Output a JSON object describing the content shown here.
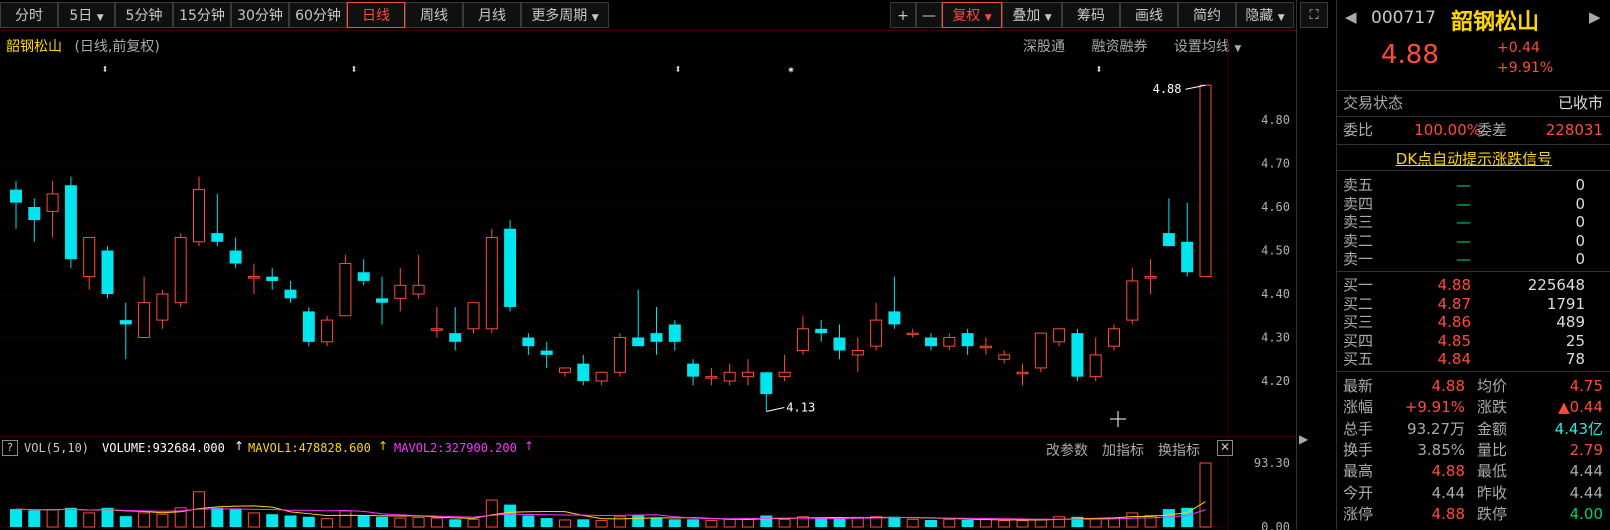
{
  "toolbar": {
    "left_buttons": [
      "分时",
      "5日",
      "5分钟",
      "15分钟",
      "30分钟",
      "60分钟",
      "日线",
      "周线",
      "月线",
      "更多周期"
    ],
    "right_buttons": [
      "+",
      "—",
      "复权",
      "叠加",
      "筹码",
      "画线",
      "简约",
      "隐藏"
    ],
    "active": "日线"
  },
  "chart_header": {
    "stock_name": "韶钢松山",
    "mode": "(日线,前复权)",
    "links": [
      "深股通",
      "融资融券",
      "设置均线"
    ]
  },
  "price_axis": [
    "4.80",
    "4.70",
    "4.60",
    "4.50",
    "4.40",
    "4.30",
    "4.20"
  ],
  "annotations": {
    "high_label": "4.88",
    "low_label": "4.13"
  },
  "volume_header": {
    "indicator": "VOL(5,10)",
    "volume": "VOLUME:932684.000",
    "mavol1": "MAVOL1:478828.600",
    "mavol2": "MAVOL2:327900.200",
    "links": [
      "改参数",
      "加指标",
      "换指标"
    ]
  },
  "volume_axis": [
    "93.30",
    "0.00"
  ],
  "chart_data": {
    "type": "candlestick",
    "ylim": [
      4.13,
      4.88
    ],
    "candles": [
      [
        4.64,
        4.66,
        4.55,
        4.61
      ],
      [
        4.6,
        4.62,
        4.52,
        4.57
      ],
      [
        4.59,
        4.66,
        4.53,
        4.63
      ],
      [
        4.65,
        4.67,
        4.46,
        4.48
      ],
      [
        4.44,
        4.52,
        4.41,
        4.53
      ],
      [
        4.5,
        4.51,
        4.39,
        4.4
      ],
      [
        4.34,
        4.38,
        4.25,
        4.33
      ],
      [
        4.3,
        4.44,
        4.3,
        4.38
      ],
      [
        4.34,
        4.41,
        4.32,
        4.4
      ],
      [
        4.38,
        4.54,
        4.37,
        4.53
      ],
      [
        4.52,
        4.67,
        4.51,
        4.64
      ],
      [
        4.54,
        4.63,
        4.51,
        4.52
      ],
      [
        4.5,
        4.53,
        4.46,
        4.47
      ],
      [
        4.44,
        4.47,
        4.4,
        4.44
      ],
      [
        4.44,
        4.46,
        4.41,
        4.43
      ],
      [
        4.41,
        4.43,
        4.38,
        4.39
      ],
      [
        4.36,
        4.37,
        4.28,
        4.29
      ],
      [
        4.29,
        4.35,
        4.28,
        4.34
      ],
      [
        4.35,
        4.49,
        4.35,
        4.47
      ],
      [
        4.45,
        4.48,
        4.42,
        4.43
      ],
      [
        4.39,
        4.44,
        4.33,
        4.38
      ],
      [
        4.39,
        4.46,
        4.36,
        4.42
      ],
      [
        4.4,
        4.49,
        4.39,
        4.42
      ],
      [
        4.32,
        4.37,
        4.3,
        4.32
      ],
      [
        4.31,
        4.37,
        4.27,
        4.29
      ],
      [
        4.32,
        4.37,
        4.31,
        4.38
      ],
      [
        4.32,
        4.55,
        4.31,
        4.53
      ],
      [
        4.55,
        4.57,
        4.36,
        4.37
      ],
      [
        4.3,
        4.31,
        4.26,
        4.28
      ],
      [
        4.27,
        4.29,
        4.23,
        4.26
      ],
      [
        4.22,
        4.23,
        4.21,
        4.23
      ],
      [
        4.24,
        4.26,
        4.19,
        4.2
      ],
      [
        4.2,
        4.22,
        4.19,
        4.22
      ],
      [
        4.22,
        4.31,
        4.21,
        4.3
      ],
      [
        4.3,
        4.41,
        4.3,
        4.28
      ],
      [
        4.31,
        4.37,
        4.26,
        4.29
      ],
      [
        4.33,
        4.34,
        4.27,
        4.29
      ],
      [
        4.24,
        4.25,
        4.19,
        4.21
      ],
      [
        4.21,
        4.23,
        4.19,
        4.21
      ],
      [
        4.2,
        4.24,
        4.19,
        4.22
      ],
      [
        4.21,
        4.25,
        4.19,
        4.22
      ],
      [
        4.22,
        4.22,
        4.13,
        4.17
      ],
      [
        4.21,
        4.26,
        4.2,
        4.22
      ],
      [
        4.27,
        4.35,
        4.26,
        4.32
      ],
      [
        4.32,
        4.34,
        4.29,
        4.31
      ],
      [
        4.3,
        4.33,
        4.25,
        4.27
      ],
      [
        4.26,
        4.3,
        4.22,
        4.27
      ],
      [
        4.28,
        4.38,
        4.27,
        4.34
      ],
      [
        4.36,
        4.44,
        4.32,
        4.33
      ],
      [
        4.31,
        4.32,
        4.3,
        4.31
      ],
      [
        4.3,
        4.31,
        4.27,
        4.28
      ],
      [
        4.28,
        4.31,
        4.27,
        4.3
      ],
      [
        4.31,
        4.32,
        4.26,
        4.28
      ],
      [
        4.28,
        4.3,
        4.26,
        4.28
      ],
      [
        4.25,
        4.27,
        4.24,
        4.26
      ],
      [
        4.22,
        4.24,
        4.19,
        4.22
      ],
      [
        4.23,
        4.29,
        4.22,
        4.31
      ],
      [
        4.29,
        4.32,
        4.28,
        4.32
      ],
      [
        4.31,
        4.32,
        4.2,
        4.21
      ],
      [
        4.21,
        4.3,
        4.2,
        4.26
      ],
      [
        4.28,
        4.33,
        4.27,
        4.32
      ],
      [
        4.34,
        4.46,
        4.33,
        4.43
      ],
      [
        4.44,
        4.48,
        4.4,
        4.44
      ],
      [
        4.54,
        4.62,
        4.51,
        4.51
      ],
      [
        4.52,
        4.61,
        4.44,
        4.45
      ],
      [
        4.44,
        4.88,
        4.44,
        4.88
      ]
    ],
    "volumes": [
      0.28,
      0.26,
      0.27,
      0.3,
      0.22,
      0.3,
      0.17,
      0.22,
      0.2,
      0.3,
      0.55,
      0.3,
      0.28,
      0.22,
      0.2,
      0.18,
      0.16,
      0.13,
      0.25,
      0.18,
      0.16,
      0.14,
      0.15,
      0.14,
      0.12,
      0.12,
      0.42,
      0.35,
      0.18,
      0.14,
      0.11,
      0.12,
      0.1,
      0.16,
      0.18,
      0.15,
      0.12,
      0.12,
      0.1,
      0.12,
      0.13,
      0.18,
      0.12,
      0.16,
      0.14,
      0.14,
      0.15,
      0.16,
      0.16,
      0.12,
      0.11,
      0.12,
      0.11,
      0.12,
      0.1,
      0.1,
      0.12,
      0.16,
      0.16,
      0.13,
      0.14,
      0.22,
      0.18,
      0.28,
      0.3,
      1.0
    ]
  },
  "quote": {
    "code": "000717",
    "name": "韶钢松山",
    "price": "4.88",
    "change": "+0.44",
    "change_pct": "+9.91%",
    "trade_status_label": "交易状态",
    "trade_status": "已收市",
    "weibi_label": "委比",
    "weibi": "100.00%",
    "weicha_label": "委差",
    "weicha": "228031",
    "dk_link": "DK点自动提示涨跌信号",
    "sell": [
      {
        "label": "卖五",
        "price": "—",
        "vol": "0"
      },
      {
        "label": "卖四",
        "price": "—",
        "vol": "0"
      },
      {
        "label": "卖三",
        "price": "—",
        "vol": "0"
      },
      {
        "label": "卖二",
        "price": "—",
        "vol": "0"
      },
      {
        "label": "卖一",
        "price": "—",
        "vol": "0"
      }
    ],
    "buy": [
      {
        "label": "买一",
        "price": "4.88",
        "vol": "225648"
      },
      {
        "label": "买二",
        "price": "4.87",
        "vol": "1791"
      },
      {
        "label": "买三",
        "price": "4.86",
        "vol": "489"
      },
      {
        "label": "买四",
        "price": "4.85",
        "vol": "25"
      },
      {
        "label": "买五",
        "price": "4.84",
        "vol": "78"
      }
    ],
    "stats": [
      {
        "l1": "最新",
        "v1": "4.88",
        "c1": "red",
        "l2": "均价",
        "v2": "4.75",
        "c2": "red"
      },
      {
        "l1": "涨幅",
        "v1": "+9.91%",
        "c1": "red",
        "l2": "涨跌",
        "v2": "▲0.44",
        "c2": "red"
      },
      {
        "l1": "总手",
        "v1": "93.27万",
        "c1": "muted",
        "l2": "金额",
        "v2": "4.43亿",
        "c2": "cyan"
      },
      {
        "l1": "换手",
        "v1": "3.85%",
        "c1": "muted",
        "l2": "量比",
        "v2": "2.79",
        "c2": "red"
      },
      {
        "l1": "最高",
        "v1": "4.88",
        "c1": "red",
        "l2": "最低",
        "v2": "4.44",
        "c2": "muted"
      },
      {
        "l1": "今开",
        "v1": "4.44",
        "c1": "muted",
        "l2": "昨收",
        "v2": "4.44",
        "c2": "muted"
      },
      {
        "l1": "涨停",
        "v1": "4.88",
        "c1": "red",
        "l2": "跌停",
        "v2": "4.00",
        "c2": "green"
      }
    ]
  },
  "colors": {
    "up": "#ff4b3a",
    "down": "#00e5ee",
    "mavol1": "#ffd700",
    "mavol2": "#ff33ff"
  }
}
